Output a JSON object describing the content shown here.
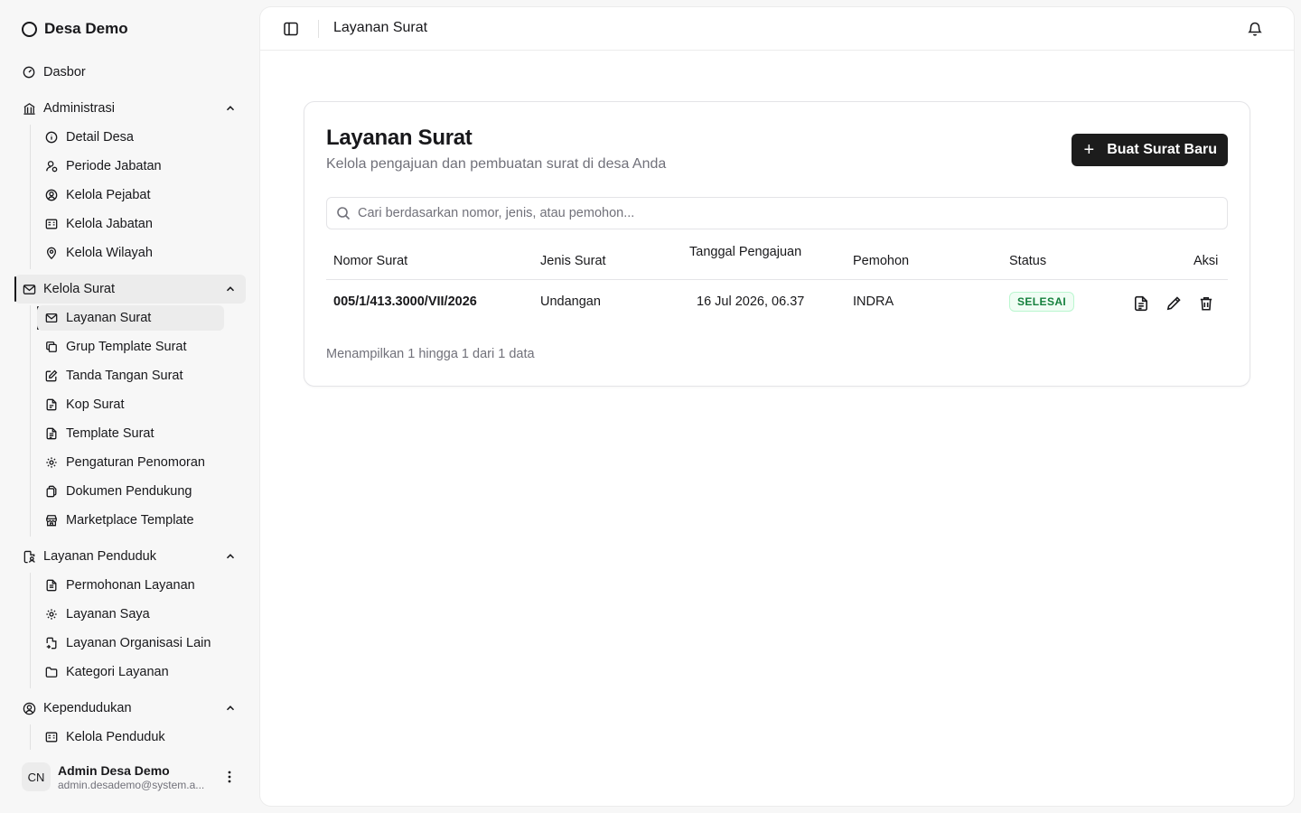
{
  "brand": {
    "name": "Desa Demo"
  },
  "sidebar": {
    "dashboard": "Dasbor",
    "administrasi": {
      "label": "Administrasi",
      "items": [
        "Detail Desa",
        "Periode Jabatan",
        "Kelola Pejabat",
        "Kelola Jabatan",
        "Kelola Wilayah"
      ]
    },
    "kelola_surat": {
      "label": "Kelola Surat",
      "items": [
        "Layanan Surat",
        "Grup Template Surat",
        "Tanda Tangan Surat",
        "Kop Surat",
        "Template Surat",
        "Pengaturan Penomoran",
        "Dokumen Pendukung",
        "Marketplace Template"
      ]
    },
    "layanan_penduduk": {
      "label": "Layanan Penduduk",
      "items": [
        "Permohonan Layanan",
        "Layanan Saya",
        "Layanan Organisasi Lain",
        "Kategori Layanan"
      ]
    },
    "kependudukan": {
      "label": "Kependudukan",
      "items": [
        "Kelola Penduduk"
      ]
    }
  },
  "user": {
    "initials": "CN",
    "name": "Admin Desa Demo",
    "email": "admin.desademo@system.a..."
  },
  "topbar": {
    "title": "Layanan Surat"
  },
  "page": {
    "title": "Layanan Surat",
    "subtitle": "Kelola pengajuan dan pembuatan surat di desa Anda",
    "new_button": "Buat Surat Baru",
    "search_placeholder": "Cari berdasarkan nomor, jenis, atau pemohon..."
  },
  "table": {
    "headers": [
      "Nomor Surat",
      "Jenis Surat",
      "Tanggal Pengajuan",
      "Pemohon",
      "Status",
      "Aksi"
    ],
    "rows": [
      {
        "nomor": "005/1/413.3000/VII/2026",
        "jenis": "Undangan",
        "tanggal": "16 Jul 2026, 06.37",
        "pemohon": "INDRA",
        "status": "SELESAI"
      }
    ],
    "footer": "Menampilkan 1 hingga 1 dari 1 data"
  },
  "colors": {
    "primary": "#1c1c1c",
    "status_success": "#15803d",
    "muted": "#71717a"
  }
}
